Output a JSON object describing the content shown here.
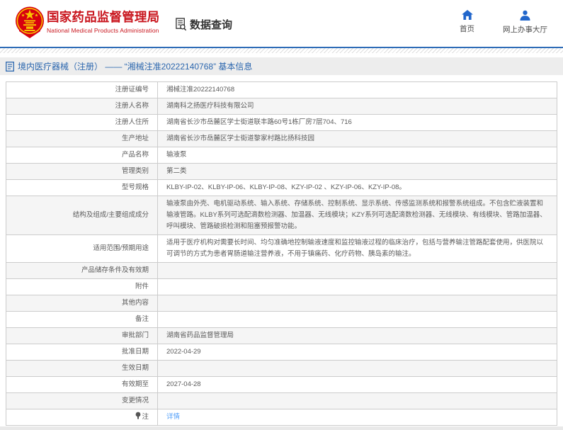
{
  "header": {
    "agency_cn": "国家药品监督管理局",
    "agency_en": "National Medical Products Administration",
    "section": "数据查询",
    "nav": [
      {
        "label": "首页",
        "icon": "home-icon"
      },
      {
        "label": "网上办事大厅",
        "icon": "user-icon"
      }
    ]
  },
  "titlebar": {
    "title": "境内医疗器械（注册） —— “湘械注准20222140768” 基本信息"
  },
  "table": {
    "rows": [
      {
        "label": "注册证编号",
        "value": "湘械注准20222140768"
      },
      {
        "label": "注册人名称",
        "value": "湖南科之扬医疗科技有限公司"
      },
      {
        "label": "注册人住所",
        "value": "湖南省长沙市岳麓区学士街道联丰路60号1栋厂房7层704、716"
      },
      {
        "label": "生产地址",
        "value": "湖南省长沙市岳麓区学士街道黎家村路比扬科技园"
      },
      {
        "label": "产品名称",
        "value": "输液泵"
      },
      {
        "label": "管理类别",
        "value": "第二类"
      },
      {
        "label": "型号规格",
        "value": "KLBY-IP-02、KLBY-IP-06、KLBY-IP-08、KZY-IP-02 、KZY-IP-06、KZY-IP-08。"
      },
      {
        "label": "结构及组成/主要组成成分",
        "value": "输液泵由外壳、电机驱动系统、输入系统、存储系统、控制系统、显示系统、传感监测系统和报警系统组成。不包含贮液装置和输液管路。KLBY系列可选配滴数检测器、加温器、无线模块；KZY系列可选配滴数检测器、无线模块、有线模块、管路加温器、呼叫模块、管路破损检测和阻塞预报警功能。"
      },
      {
        "label": "适用范围/预期用途",
        "value": "适用于医疗机构对需要长时间、均匀准确地控制输液速度和监控输液过程的临床治疗，包括与营养输注管路配套使用，供医院以可调节的方式为患者胃肠道输注营养液，不用于镇痛药、化疗药物、胰岛素的输注。"
      },
      {
        "label": "产品储存条件及有效期",
        "value": ""
      },
      {
        "label": "附件",
        "value": ""
      },
      {
        "label": "其他内容",
        "value": ""
      },
      {
        "label": "备注",
        "value": ""
      },
      {
        "label": "审批部门",
        "value": "湖南省药品监督管理局"
      },
      {
        "label": "批准日期",
        "value": "2022-04-29"
      },
      {
        "label": "生效日期",
        "value": ""
      },
      {
        "label": "有效期至",
        "value": "2027-04-28"
      },
      {
        "label": "变更情况",
        "value": ""
      },
      {
        "label": "注",
        "value": "详情",
        "link": true,
        "icon": "note-icon"
      }
    ]
  },
  "colors": {
    "brand_red": "#c9161e",
    "nav_blue": "#2166cb",
    "title_blue": "#2b66ae",
    "link_blue": "#4f9df8",
    "divider_blue": "#2e6cb7"
  }
}
